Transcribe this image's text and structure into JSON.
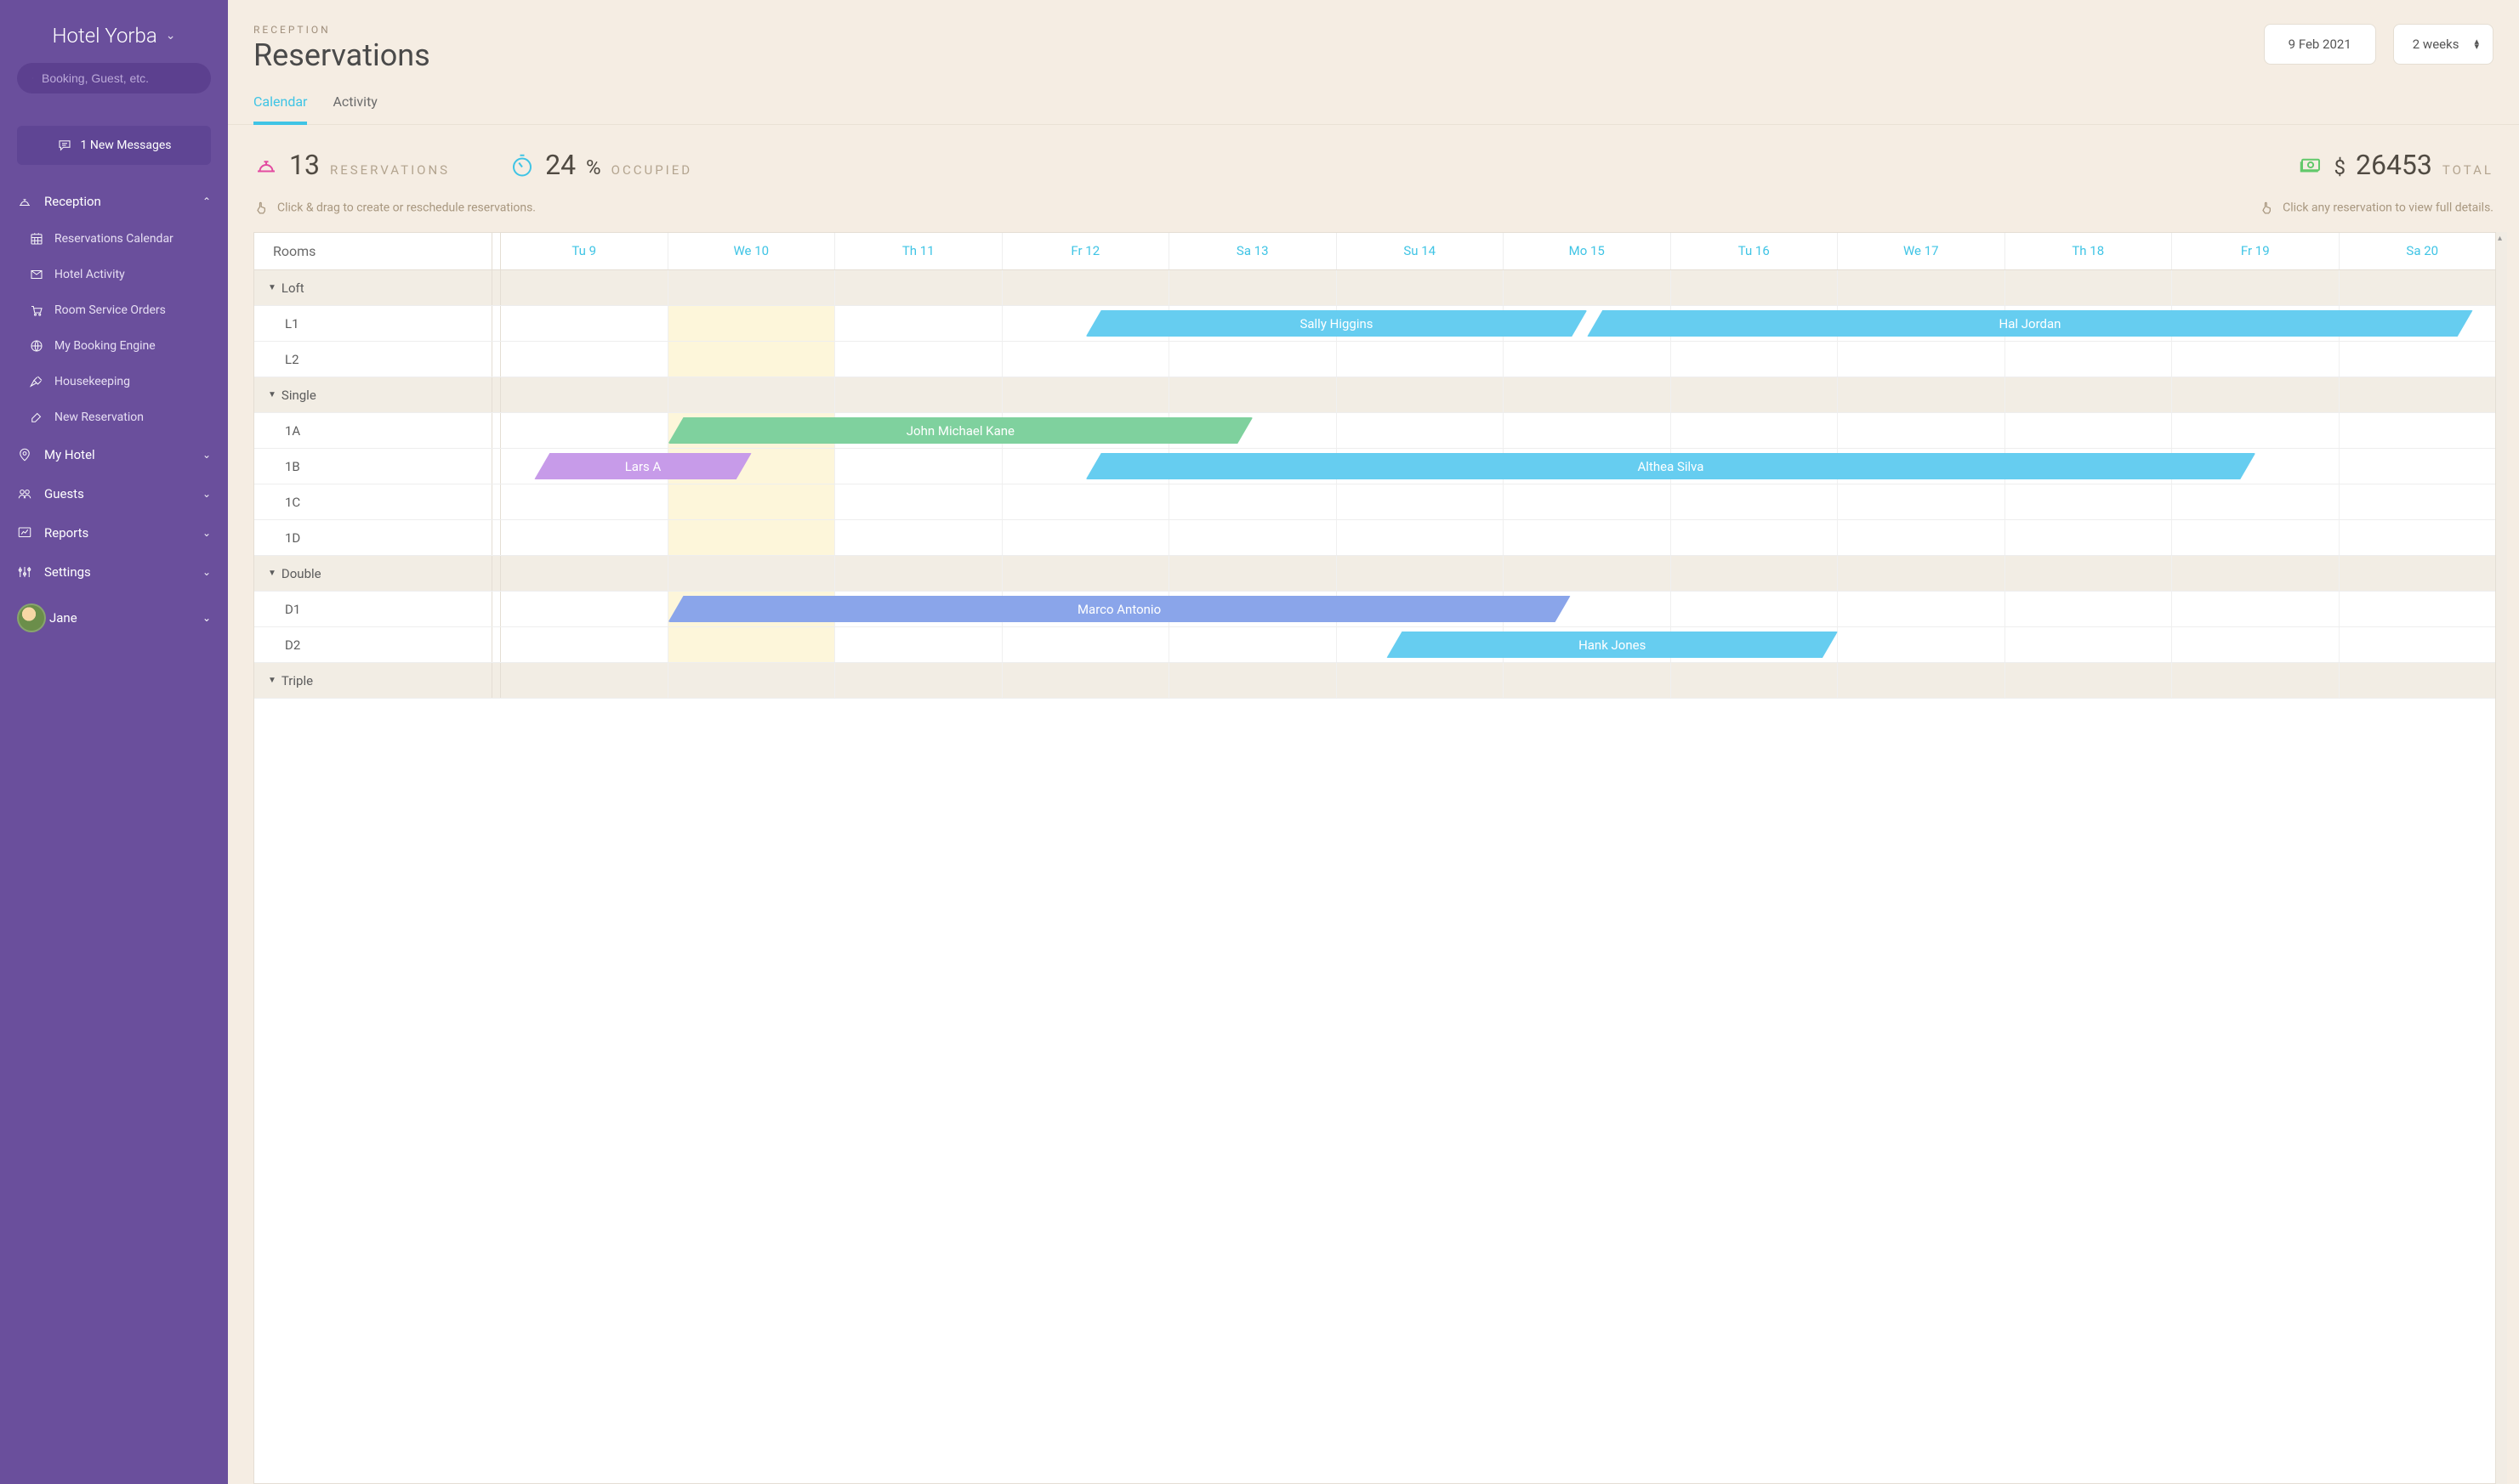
{
  "sidebar": {
    "hotel_name": "Hotel Yorba",
    "search_placeholder": "Booking, Guest, etc.",
    "messages_label": "1 New Messages",
    "sections": [
      {
        "label": "Reception",
        "expanded": true,
        "icon": "desk-bell-icon",
        "items": [
          {
            "label": "Reservations Calendar",
            "icon": "calendar-grid-icon"
          },
          {
            "label": "Hotel Activity",
            "icon": "inbox-icon"
          },
          {
            "label": "Room Service Orders",
            "icon": "cart-icon"
          },
          {
            "label": "My Booking Engine",
            "icon": "globe-icon"
          },
          {
            "label": "Housekeeping",
            "icon": "broom-icon"
          },
          {
            "label": "New Reservation",
            "icon": "edit-icon"
          }
        ]
      },
      {
        "label": "My Hotel",
        "expanded": false,
        "icon": "pin-icon"
      },
      {
        "label": "Guests",
        "expanded": false,
        "icon": "people-icon"
      },
      {
        "label": "Reports",
        "expanded": false,
        "icon": "chart-icon"
      },
      {
        "label": "Settings",
        "expanded": false,
        "icon": "sliders-icon"
      }
    ],
    "user_name": "Jane"
  },
  "header": {
    "crumb": "RECEPTION",
    "title": "Reservations",
    "date_label": "9 Feb 2021",
    "range_label": "2 weeks"
  },
  "tabs": [
    {
      "label": "Calendar",
      "active": true
    },
    {
      "label": "Activity",
      "active": false
    }
  ],
  "stats": {
    "reservations_value": "13",
    "reservations_label": "RESERVATIONS",
    "occupied_value": "24",
    "occupied_unit": "%",
    "occupied_label": "OCCUPIED",
    "total_currency": "$",
    "total_value": "26453",
    "total_label": "TOTAL"
  },
  "hints": {
    "drag": "Click & drag to create or reschedule reservations.",
    "view": "Click any reservation to view full details."
  },
  "calendar": {
    "rooms_header": "Rooms",
    "today_index": 1,
    "days": [
      "Tu 9",
      "We 10",
      "Th 11",
      "Fr 12",
      "Sa 13",
      "Su 14",
      "Mo 15",
      "Tu 16",
      "We 17",
      "Th 18",
      "Fr 19",
      "Sa 20"
    ],
    "rows": [
      {
        "type": "group",
        "label": "Loft"
      },
      {
        "type": "room",
        "label": "L1",
        "res": [
          {
            "name": "Sally Higgins",
            "color": "blue",
            "start": 3.5,
            "span": 3
          },
          {
            "name": "Hal Jordan",
            "color": "blue",
            "start": 6.5,
            "span": 5.3
          }
        ]
      },
      {
        "type": "room",
        "label": "L2"
      },
      {
        "type": "group",
        "label": "Single"
      },
      {
        "type": "room",
        "label": "1A",
        "res": [
          {
            "name": "John Michael Kane",
            "color": "green",
            "start": 1,
            "span": 3.5
          }
        ]
      },
      {
        "type": "room",
        "label": "1B",
        "res": [
          {
            "name": "Lars A",
            "color": "purple",
            "start": 0.2,
            "span": 1.3
          },
          {
            "name": "Althea Silva",
            "color": "blue",
            "start": 3.5,
            "span": 7
          }
        ]
      },
      {
        "type": "room",
        "label": "1C"
      },
      {
        "type": "room",
        "label": "1D"
      },
      {
        "type": "group",
        "label": "Double"
      },
      {
        "type": "room",
        "label": "D1",
        "res": [
          {
            "name": "Marco Antonio",
            "color": "periwinkle",
            "start": 1,
            "span": 5.4
          }
        ]
      },
      {
        "type": "room",
        "label": "D2",
        "res": [
          {
            "name": "Hank Jones",
            "color": "blue",
            "start": 5.3,
            "span": 2.7
          }
        ]
      },
      {
        "type": "group",
        "label": "Triple"
      }
    ]
  }
}
